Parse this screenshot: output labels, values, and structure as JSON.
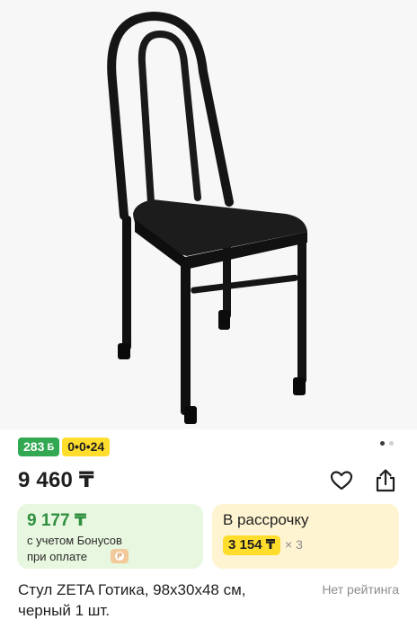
{
  "product": {
    "image_alt": "chair-photo",
    "badges": {
      "bonus_count": "283",
      "bonus_symbol": "Б",
      "installment_tag": "0•0•24"
    },
    "gallery": {
      "dots_total": 2,
      "active_index": 0
    },
    "price": "9 460 ₸",
    "bonus_card": {
      "price": "9 177 ₸",
      "line1": "с учетом Бонусов",
      "line2": "при оплате"
    },
    "installment_card": {
      "title": "В рассрочку",
      "amount": "3 154 ₸",
      "multiplier": "× 3"
    },
    "title_line1": "Стул ZETA Готика, 98х30х48 см,",
    "title_line2": "черный 1 шт.",
    "rating_text": "Нет рейтинга"
  },
  "colors": {
    "bonus_green": "#32a852",
    "price_green": "#2f8f3f",
    "accent_yellow": "#ffdd2d"
  },
  "icons": [
    "heart-icon",
    "share-icon",
    "coin-icon"
  ]
}
